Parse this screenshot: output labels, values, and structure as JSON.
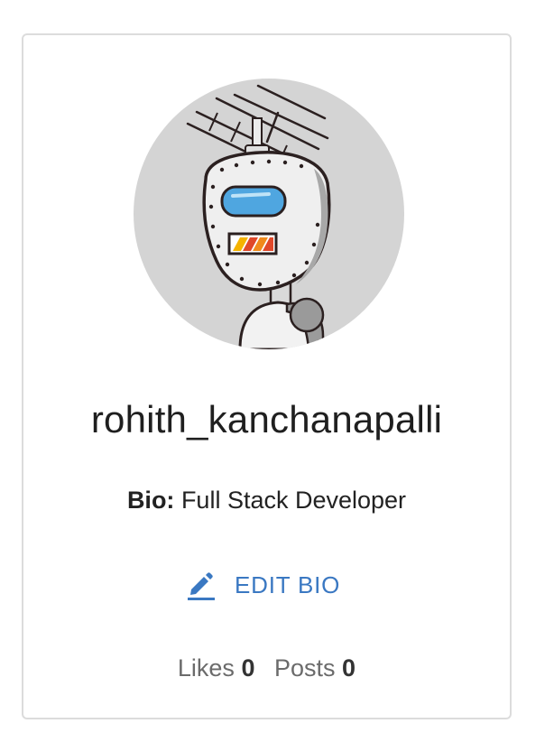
{
  "profile": {
    "username": "rohith_kanchanapalli",
    "bio_label": "Bio:",
    "bio_text": "Full Stack Developer",
    "edit_bio_label": "EDIT BIO",
    "avatar_icon": "robot-avatar-icon",
    "edit_icon": "pencil-icon"
  },
  "stats": {
    "likes_label": "Likes",
    "likes_count": "0",
    "posts_label": "Posts",
    "posts_count": "0"
  },
  "colors": {
    "accent": "#3a78c2",
    "avatar_bg": "#d4d4d4",
    "card_border": "#dcdcdc"
  }
}
